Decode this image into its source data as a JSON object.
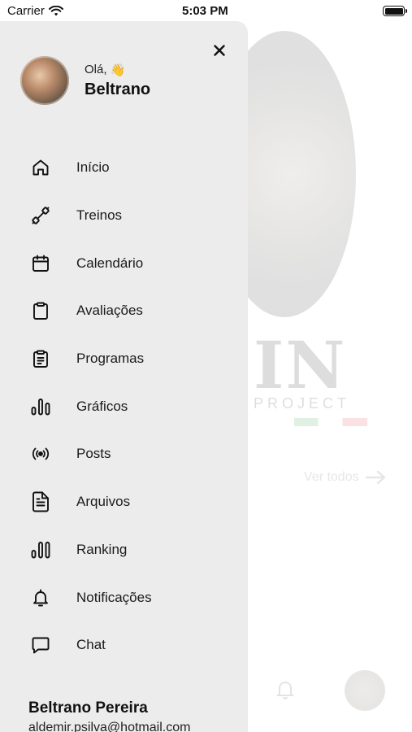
{
  "status_bar": {
    "carrier": "Carrier",
    "time": "5:03 PM"
  },
  "background": {
    "logo_text": "IN",
    "project_text": "PROJECT",
    "see_all": "Ver todos"
  },
  "drawer": {
    "greeting": "Olá,",
    "greeting_emoji": "👋",
    "user_first_name": "Beltrano",
    "menu": [
      {
        "label": "Início",
        "icon": "home-icon"
      },
      {
        "label": "Treinos",
        "icon": "dumbbell-icon"
      },
      {
        "label": "Calendário",
        "icon": "calendar-icon"
      },
      {
        "label": "Avaliações",
        "icon": "clipboard-icon"
      },
      {
        "label": "Programas",
        "icon": "clipboard-list-icon"
      },
      {
        "label": "Gráficos",
        "icon": "bar-chart-icon"
      },
      {
        "label": "Posts",
        "icon": "broadcast-icon"
      },
      {
        "label": "Arquivos",
        "icon": "file-icon"
      },
      {
        "label": "Ranking",
        "icon": "ranking-chart-icon"
      },
      {
        "label": "Notificações",
        "icon": "bell-icon"
      },
      {
        "label": "Chat",
        "icon": "chat-icon"
      }
    ],
    "footer": {
      "full_name": "Beltrano Pereira",
      "email": "aldemir.psilva@hotmail.com"
    }
  },
  "colors": {
    "drawer_bg": "#ececec",
    "text": "#111111"
  }
}
